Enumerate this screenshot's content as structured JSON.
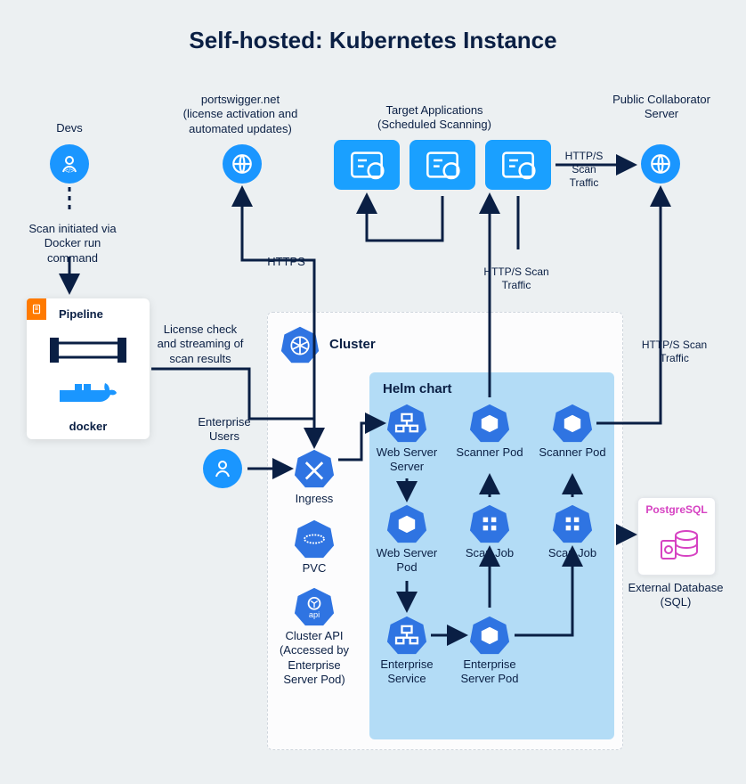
{
  "title": "Self-hosted: Kubernetes Instance",
  "top": {
    "devs": "Devs",
    "portswigger": "portswigger.net",
    "portswigger_sub": "(license activation and automated updates)",
    "target_apps": "Target Applications",
    "target_apps_sub": "(Scheduled Scanning)",
    "collaborator": "Public Collaborator Server"
  },
  "left": {
    "scan_initiated": "Scan initiated via Docker run command",
    "pipeline": "Pipeline",
    "docker": "docker",
    "license_check": "License check and streaming of scan results",
    "enterprise_users": "Enterprise Users"
  },
  "edges": {
    "https": "HTTPS",
    "scan_traffic_top": "HTTP/S Scan Traffic",
    "scan_traffic_right_mid": "HTTP/S Scan Traffic",
    "scan_traffic_right_low": "HTTP/S Scan Traffic"
  },
  "cluster": {
    "title": "Cluster",
    "ingress": "Ingress",
    "pvc": "PVC",
    "cluster_api": "Cluster API (Accessed by Enterprise Server Pod)"
  },
  "helm": {
    "title": "Helm chart",
    "web_server_svc": "Web Server Server",
    "scanner_pod_1": "Scanner Pod",
    "scanner_pod_2": "Scanner Pod",
    "web_server_pod": "Web Server Pod",
    "scan_job_1": "Scan Job",
    "scan_job_2": "Scan Job",
    "enterprise_service": "Enterprise Service",
    "enterprise_server_pod": "Enterprise Server Pod"
  },
  "right": {
    "postgresql": "PostgreSQL",
    "external_db": "External Database (SQL)"
  }
}
